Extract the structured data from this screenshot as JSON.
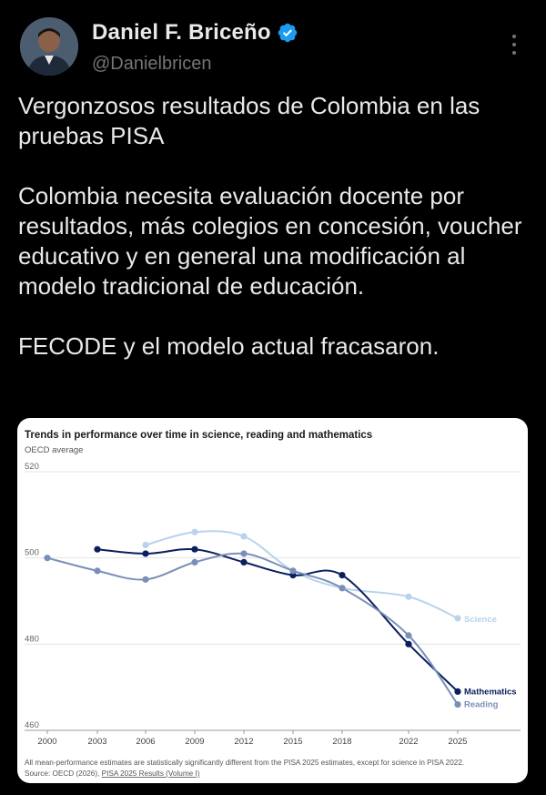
{
  "author": {
    "name": "Daniel F. Briceño",
    "handle": "@Danielbricen"
  },
  "tweet": {
    "paragraph1": "Vergonzosos resultados de Colombia en las pruebas PISA",
    "paragraph2": "Colombia necesita evaluación docente por resultados, más colegios en concesión, voucher educativo y en general una modificación al modelo tradicional de educación.",
    "paragraph3": "FECODE y el modelo actual fracasaron."
  },
  "chart_data": {
    "type": "line",
    "title": "Trends in performance over time in science, reading and mathematics",
    "subtitle": "OECD average",
    "x": [
      "2000",
      "2003",
      "2006",
      "2009",
      "2012",
      "2015",
      "2018",
      "2022",
      "2025"
    ],
    "ylim": [
      460,
      520
    ],
    "yticks": [
      "520",
      "500",
      "480",
      "460"
    ],
    "grid": true,
    "series": [
      {
        "name": "Science",
        "color": "#b9d3ec",
        "values": [
          null,
          null,
          503,
          506,
          505,
          497,
          493,
          491,
          486
        ]
      },
      {
        "name": "Mathematics",
        "color": "#0b1f5e",
        "values": [
          null,
          502,
          501,
          502,
          499,
          496,
          496,
          480,
          469
        ]
      },
      {
        "name": "Reading",
        "color": "#7a8fb8",
        "values": [
          500,
          497,
          495,
          499,
          501,
          497,
          493,
          482,
          466
        ]
      }
    ],
    "footnote": "All mean-performance estimates are statistically significantly different from the PISA 2025 estimates, except for science in PISA 2022.",
    "source_prefix": "Source: OECD (2026), ",
    "source_link": "PISA 2025 Results (Volume I)"
  },
  "colors": {
    "background": "#000000",
    "text": "#e7e9ea",
    "muted": "#71767b",
    "verified": "#1d9bf0"
  },
  "icons": [
    "verified-badge-icon",
    "more-options-icon"
  ]
}
